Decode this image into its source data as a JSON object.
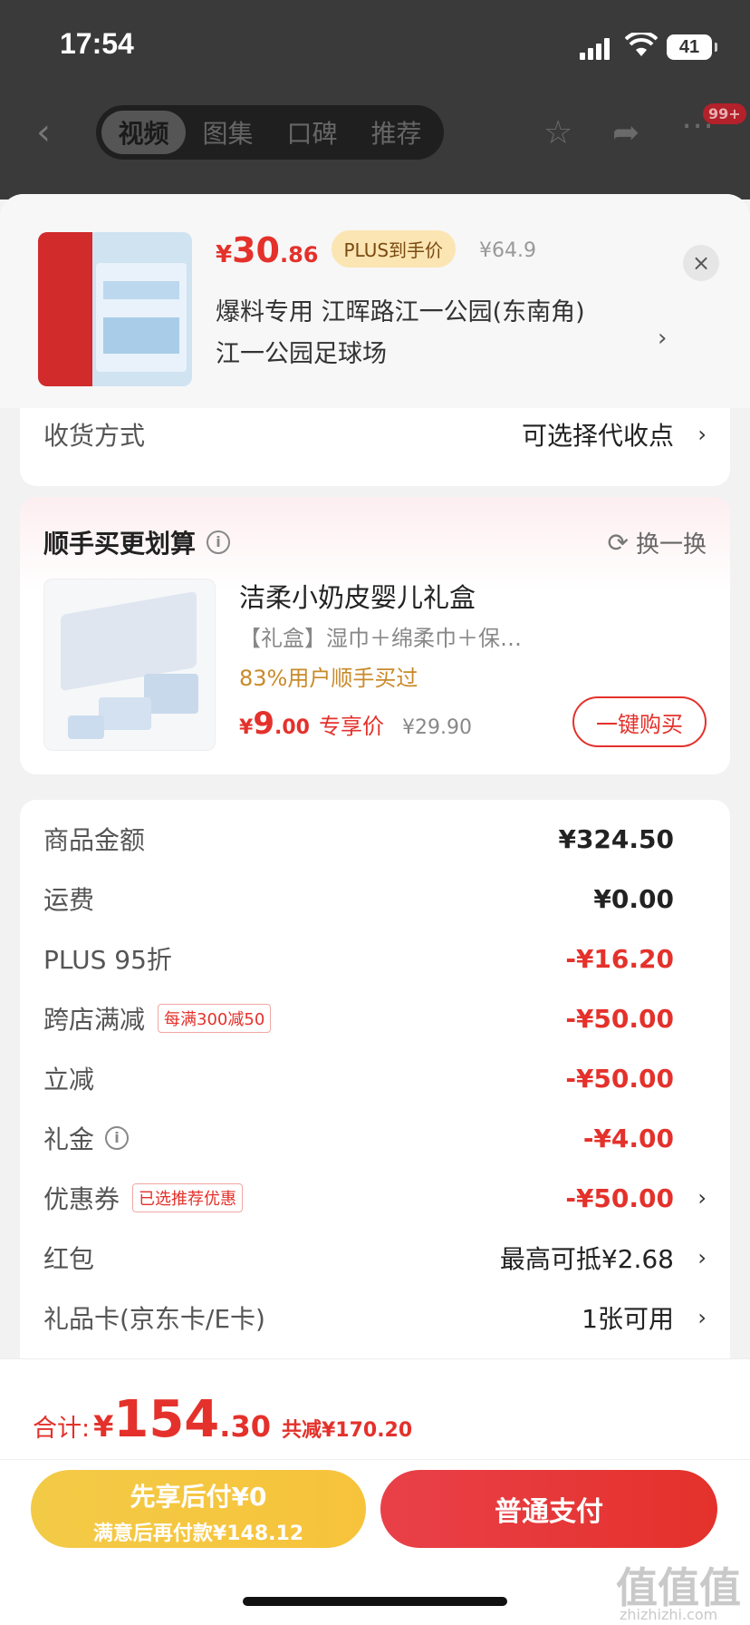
{
  "status_bar": {
    "time": "17:54",
    "battery": "41"
  },
  "nav": {
    "tabs": [
      "视频",
      "图集",
      "口碑",
      "推荐"
    ],
    "active_tab": 0,
    "badge": "99+"
  },
  "product": {
    "price_yen": "¥",
    "price_int": "30",
    "price_dec": ".86",
    "plus_label": "PLUS到手价",
    "orig_price": "¥64.9",
    "address_line1": "爆料专用  江晖路江一公园(东南角)",
    "address_line2": "江一公园足球场",
    "close": "×"
  },
  "delivery": {
    "label": "收货方式",
    "value": "可选择代收点"
  },
  "bundle": {
    "title": "顺手买更划算",
    "swap": "换一换",
    "name": "洁柔小奶皮婴儿礼盒",
    "desc": "【礼盒】湿巾＋绵柔巾＋保…",
    "stat": "83%用户顺手买过",
    "price_yen": "¥",
    "price_int": "9",
    "price_dec": ".00",
    "excl_label": "专享价",
    "orig_price": "¥29.90",
    "buy": "一键购买"
  },
  "summary": {
    "rows": [
      {
        "label": "商品金额",
        "value": "¥324.50"
      },
      {
        "label": "运费",
        "value": "¥0.00"
      },
      {
        "label": "PLUS 95折",
        "value": "-¥16.20"
      },
      {
        "label": "跨店满减",
        "tag": "每满300减50",
        "value": "-¥50.00"
      },
      {
        "label": "立减",
        "value": "-¥50.00"
      },
      {
        "label": "礼金",
        "value": "-¥4.00"
      },
      {
        "label": "优惠券",
        "tag": "已选推荐优惠",
        "value": "-¥50.00"
      },
      {
        "label": "红包",
        "value": "最高可抵¥2.68"
      },
      {
        "label": "礼品卡(京东卡/E卡)",
        "value": "1张可用"
      }
    ]
  },
  "footer": {
    "total_label": "合计:",
    "total_yen": "¥",
    "total_int": "154",
    "total_dec": ".30",
    "saved": "共减¥170.20",
    "pay_later_line1": "先享后付¥0",
    "pay_later_line2": "满意后再付款¥148.12",
    "pay_normal": "普通支付"
  },
  "watermark": {
    "text": "值值值",
    "url": "zhizhizhi.com"
  },
  "colors": {
    "accent": "#e4312b",
    "pay_later": "#f5c63f"
  }
}
